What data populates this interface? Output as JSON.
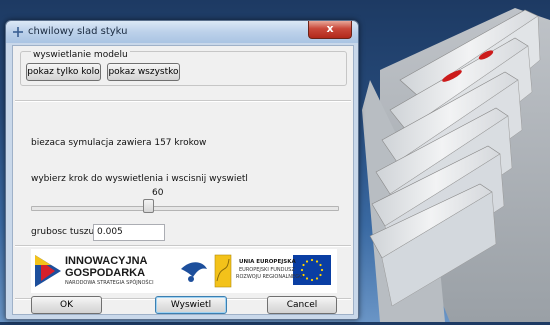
{
  "window": {
    "title": "chwilowy slad styku",
    "close_glyph": "x"
  },
  "model_group": {
    "label": "wyswietlanie modelu",
    "buttons": [
      "pokaz tylko kolo",
      "pokaz wszystko"
    ]
  },
  "simulation_info": "biezaca symulacja zawiera 157 krokow",
  "step_prompt": "wybierz krok do wyswietlenia i wscisnij wyswietl",
  "slider": {
    "value": "60",
    "min": 0,
    "max": 157
  },
  "ink": {
    "label": "grubosc tuszu",
    "value": "0.005"
  },
  "logos": {
    "ig_title_1": "INNOWACYJNA",
    "ig_title_2": "GOSPODARKA",
    "ig_subtitle": "NARODOWA STRATEGIA SPÓJNOŚCI",
    "eu_line1": "UNIA EUROPEJSKA",
    "eu_line2": "EUROPEJSKI FUNDUSZ",
    "eu_line3": "ROZWOJU REGIONALNEGO"
  },
  "footer": {
    "ok": "OK",
    "show": "Wyswietl",
    "cancel": "Cancel"
  },
  "colors": {
    "accent_red": "#cc1b1b",
    "eu_blue": "#0a3ea3",
    "eu_star": "#ffd400"
  },
  "icons": [
    "app-icon",
    "close-icon",
    "slider-thumb",
    "innowacyjna-logo",
    "hand-logo",
    "eu-flag-icon"
  ]
}
